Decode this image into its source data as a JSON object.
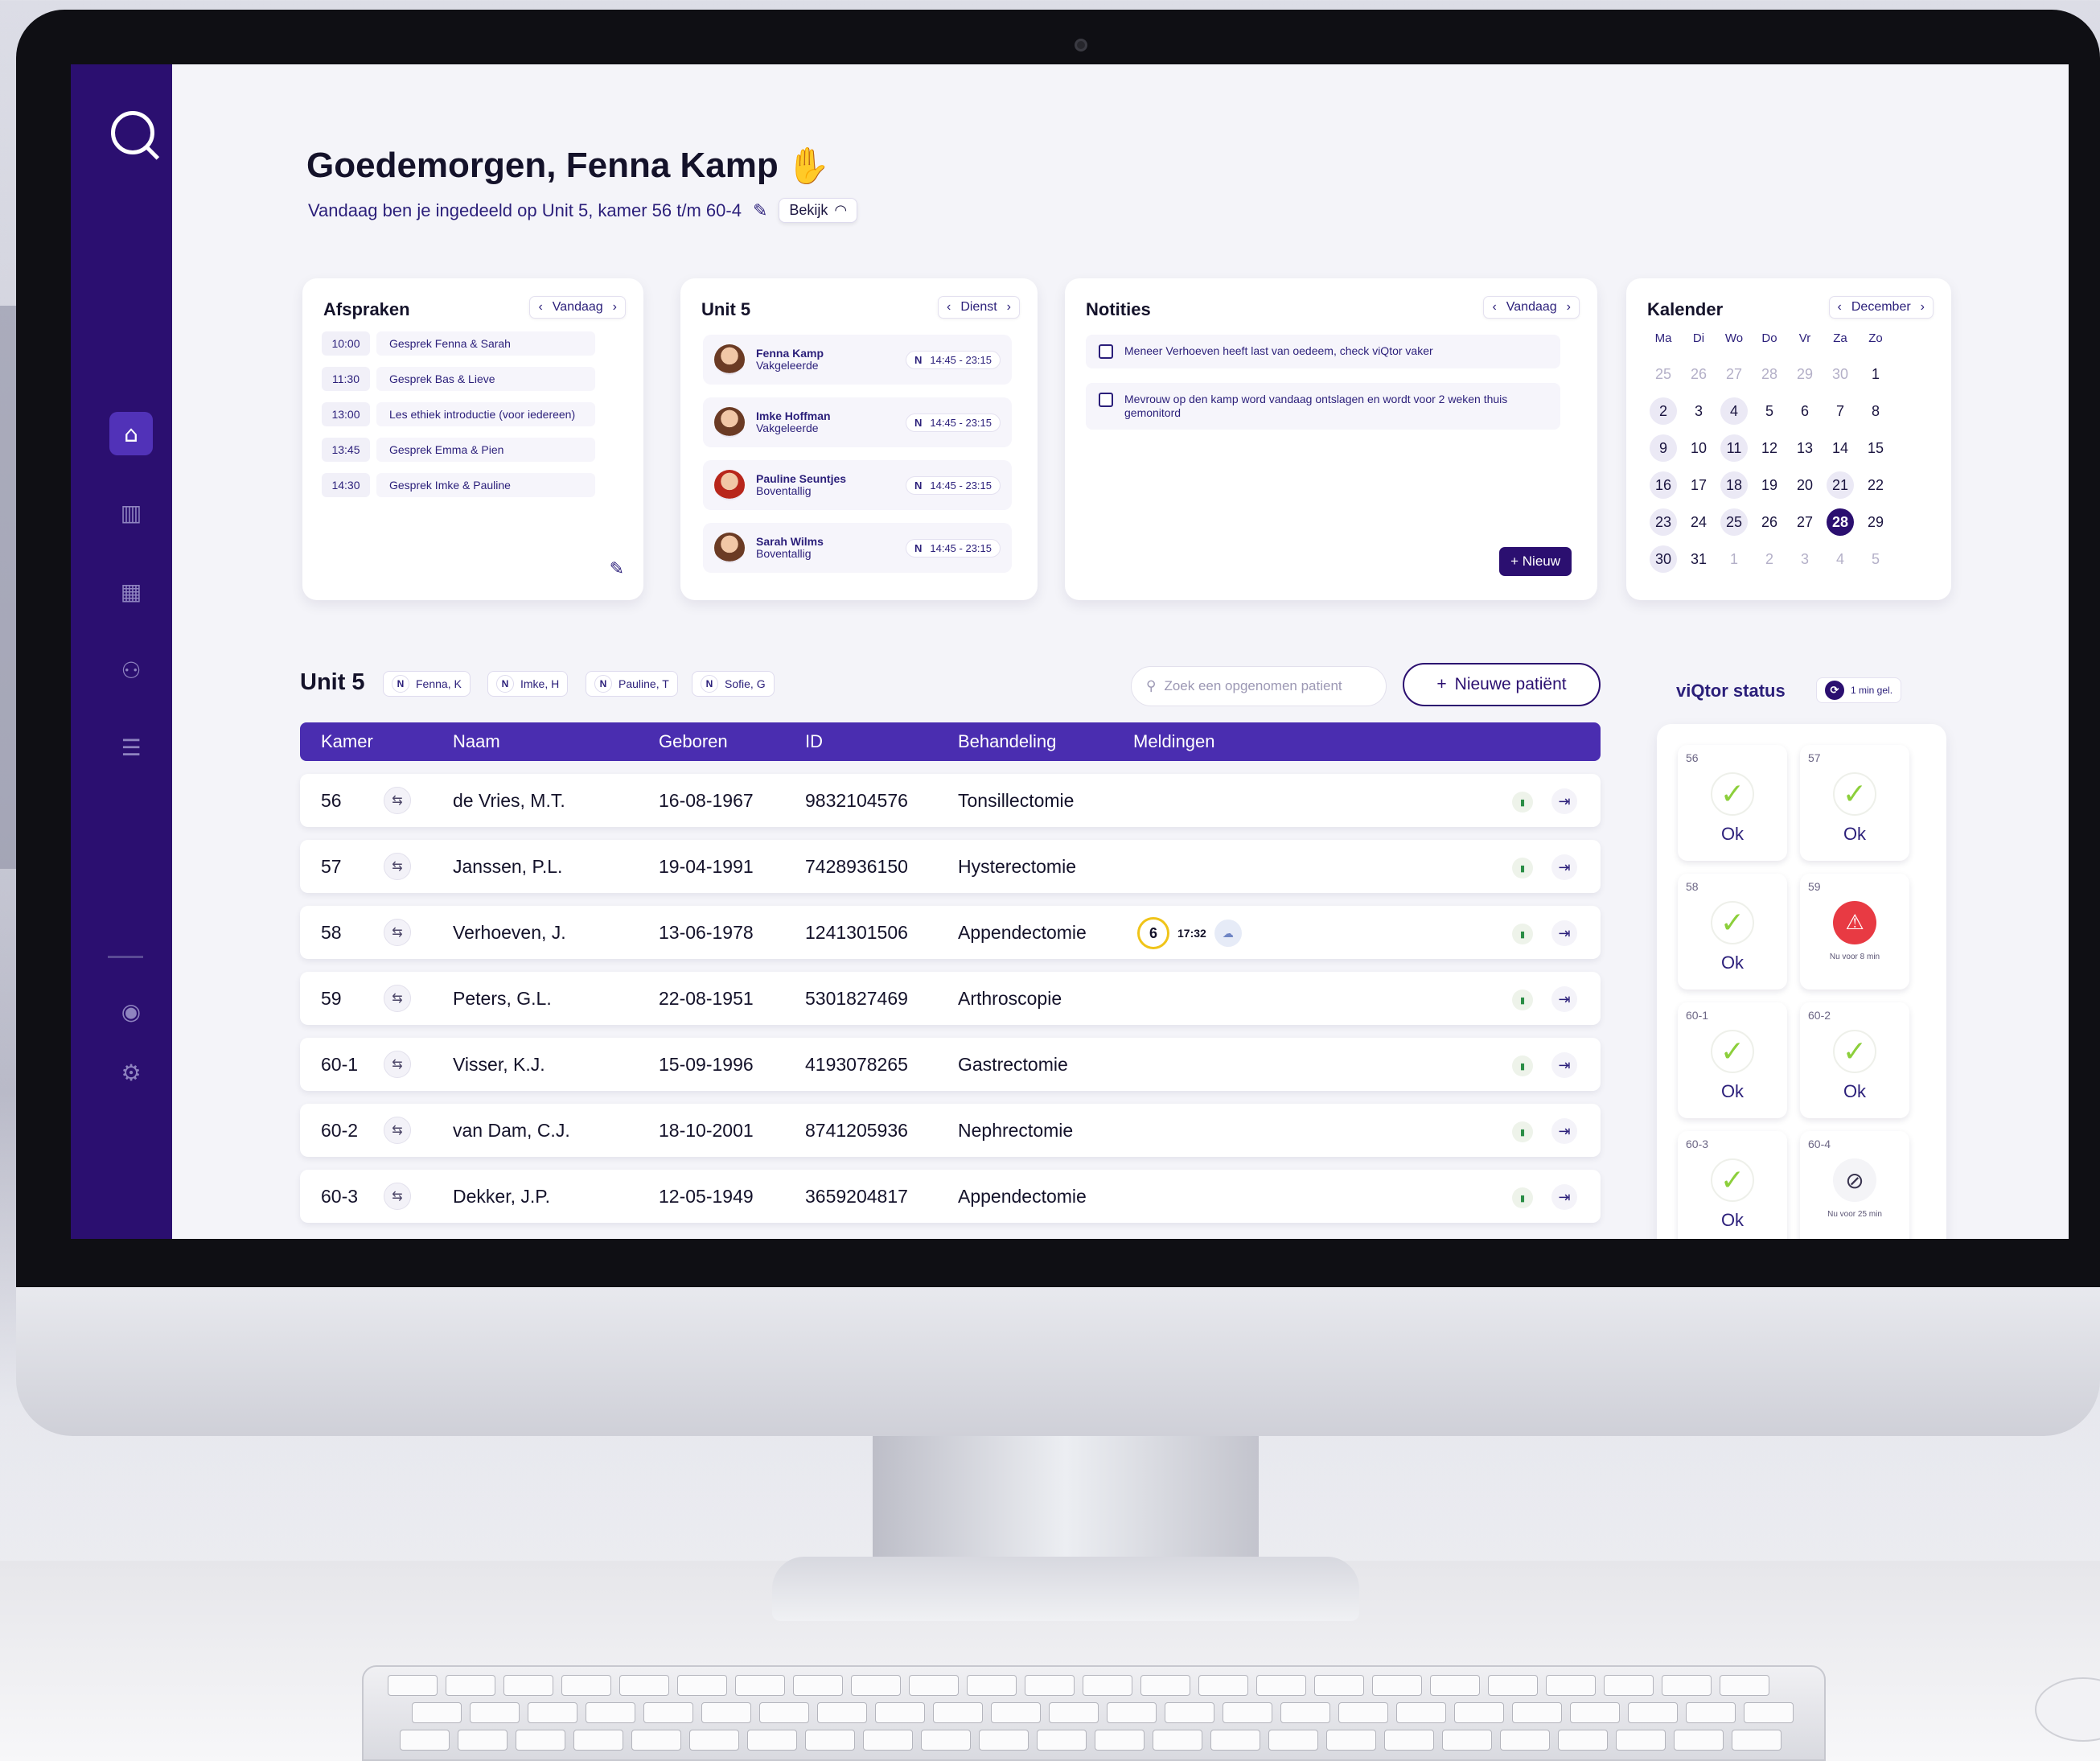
{
  "app": {
    "logo_icon": "q-logo-icon",
    "greeting": "Goedemorgen, Fenna Kamp",
    "greeting_icon": "waving-hand-icon",
    "assignment": "Vandaag ben je ingedeeld op Unit 5, kamer 56 t/m 60-4",
    "view_button": "Bekijk"
  },
  "sidebar": {
    "items": [
      {
        "name": "home",
        "icon": "home-icon",
        "active": true
      },
      {
        "name": "stats",
        "icon": "chart-icon"
      },
      {
        "name": "calendar",
        "icon": "calendar-icon"
      },
      {
        "name": "users",
        "icon": "users-icon"
      },
      {
        "name": "filters",
        "icon": "sliders-icon"
      }
    ],
    "bottom": [
      {
        "name": "profile",
        "icon": "profile-icon"
      },
      {
        "name": "settings",
        "icon": "gear-icon"
      }
    ]
  },
  "afspraken": {
    "title": "Afspraken",
    "nav_label": "Vandaag",
    "items": [
      {
        "time": "10:00",
        "name": "Gesprek Fenna & Sarah"
      },
      {
        "time": "11:30",
        "name": "Gesprek Bas & Lieve"
      },
      {
        "time": "13:00",
        "name": "Les ethiek introductie (voor iedereen)"
      },
      {
        "time": "13:45",
        "name": "Gesprek Emma & Pien"
      },
      {
        "time": "14:30",
        "name": "Gesprek Imke & Pauline"
      }
    ]
  },
  "unitcard": {
    "title": "Unit 5",
    "nav_label": "Dienst",
    "staff": [
      {
        "name": "Fenna Kamp",
        "role": "Vakgeleerde",
        "shift": "N",
        "time": "14:45 - 23:15"
      },
      {
        "name": "Imke Hoffman",
        "role": "Vakgeleerde",
        "shift": "N",
        "time": "14:45 - 23:15"
      },
      {
        "name": "Pauline Seuntjes",
        "role": "Boventallig",
        "shift": "N",
        "time": "14:45 - 23:15"
      },
      {
        "name": "Sarah Wilms",
        "role": "Boventallig",
        "shift": "N",
        "time": "14:45 - 23:15"
      }
    ]
  },
  "notities": {
    "title": "Notities",
    "nav_label": "Vandaag",
    "items": [
      "Meneer Verhoeven heeft last van oedeem, check viQtor vaker",
      "Mevrouw op den kamp word vandaag ontslagen en wordt voor 2 weken thuis gemonitord"
    ],
    "new_button": "+ Nieuw"
  },
  "kalender": {
    "title": "Kalender",
    "month": "December",
    "weekdays": [
      "Ma",
      "Di",
      "Wo",
      "Do",
      "Vr",
      "Za",
      "Zo"
    ],
    "weeks": [
      [
        "25",
        "26",
        "27",
        "28",
        "29",
        "30",
        "1"
      ],
      [
        "2",
        "3",
        "4",
        "5",
        "6",
        "7",
        "8"
      ],
      [
        "9",
        "10",
        "11",
        "12",
        "13",
        "14",
        "15"
      ],
      [
        "16",
        "17",
        "18",
        "19",
        "20",
        "21",
        "22"
      ],
      [
        "23",
        "24",
        "25",
        "26",
        "27",
        "28",
        "29"
      ],
      [
        "30",
        "31",
        "1",
        "2",
        "3",
        "4",
        "5"
      ]
    ],
    "selected": "28"
  },
  "unit": {
    "title": "Unit 5",
    "chips": [
      {
        "shift": "N",
        "name": "Fenna, K"
      },
      {
        "shift": "N",
        "name": "Imke, H"
      },
      {
        "shift": "N",
        "name": "Pauline, T"
      },
      {
        "shift": "N",
        "name": "Sofie, G"
      }
    ],
    "search_placeholder": "Zoek een opgenomen patient",
    "new_patient_button": "Nieuwe patiënt"
  },
  "table": {
    "columns": [
      "Kamer",
      "Naam",
      "Geboren",
      "ID",
      "Behandeling",
      "Meldingen"
    ],
    "rows": [
      {
        "room": "56",
        "name": "de Vries, M.T.",
        "born": "16-08-1967",
        "id": "9832104576",
        "treatment": "Tonsillectomie"
      },
      {
        "room": "57",
        "name": "Janssen, P.L.",
        "born": "19-04-1991",
        "id": "7428936150",
        "treatment": "Hysterectomie"
      },
      {
        "room": "58",
        "name": "Verhoeven, J.",
        "born": "13-06-1978",
        "id": "1241301506",
        "treatment": "Appendectomie",
        "alert": {
          "count": "6",
          "time": "17:32"
        }
      },
      {
        "room": "59",
        "name": "Peters, G.L.",
        "born": "22-08-1951",
        "id": "5301827469",
        "treatment": "Arthroscopie"
      },
      {
        "room": "60-1",
        "name": "Visser, K.J.",
        "born": "15-09-1996",
        "id": "4193078265",
        "treatment": "Gastrectomie"
      },
      {
        "room": "60-2",
        "name": "van Dam, C.J.",
        "born": "18-10-2001",
        "id": "8741205936",
        "treatment": "Nephrectomie"
      },
      {
        "room": "60-3",
        "name": "Dekker, J.P.",
        "born": "12-05-1949",
        "id": "3659204817",
        "treatment": "Appendectomie"
      }
    ]
  },
  "viqtor": {
    "title": "viQtor status",
    "badge": "1 min gel.",
    "tiles": [
      {
        "room": "56",
        "status": "Ok",
        "icon": "check-icon"
      },
      {
        "room": "57",
        "status": "Ok",
        "icon": "check-icon"
      },
      {
        "room": "58",
        "status": "Ok",
        "icon": "check-icon"
      },
      {
        "room": "59",
        "status": "Nu voor 8 min",
        "icon": "person-x-icon"
      },
      {
        "room": "60-1",
        "status": "Ok",
        "icon": "check-icon"
      },
      {
        "room": "60-2",
        "status": "Ok",
        "icon": "check-icon"
      },
      {
        "room": "60-3",
        "status": "Ok",
        "icon": "check-icon"
      },
      {
        "room": "60-4",
        "status": "Nu voor 25 min",
        "icon": "no-signal-icon"
      }
    ]
  },
  "colors": {
    "primary": "#2b0f70",
    "table_header": "#4a2db0",
    "ok_green": "#8ccf3b",
    "alert_red": "#e83a43"
  }
}
